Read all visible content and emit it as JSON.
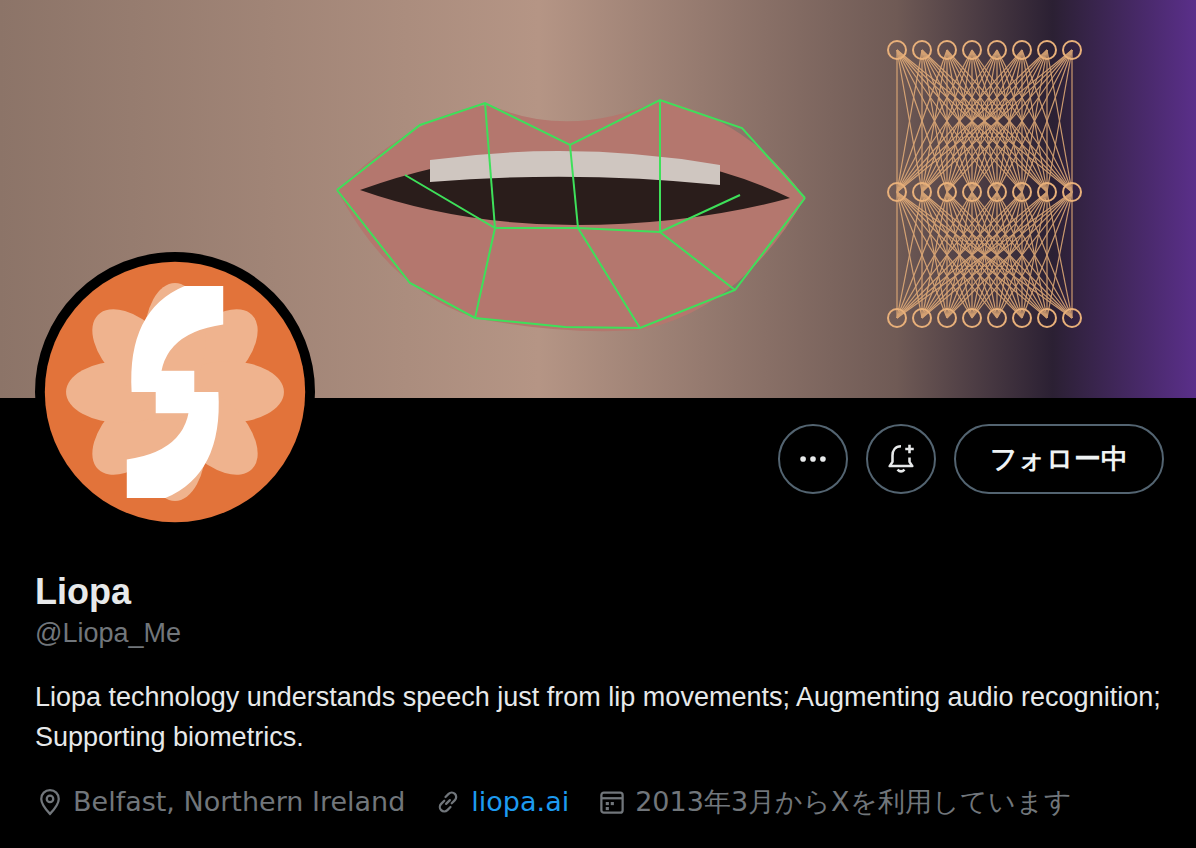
{
  "profile": {
    "name": "Liopa",
    "handle": "@Liopa_Me",
    "bio": "Liopa technology understands speech just from lip movements; Augmenting audio recognition; Supporting biometrics.",
    "location": "Belfast, Northern Ireland",
    "website": "liopa.ai",
    "joined": "2013年3月からXを利用しています"
  },
  "follow_button": {
    "label": "フォロー中",
    "following": true
  }
}
